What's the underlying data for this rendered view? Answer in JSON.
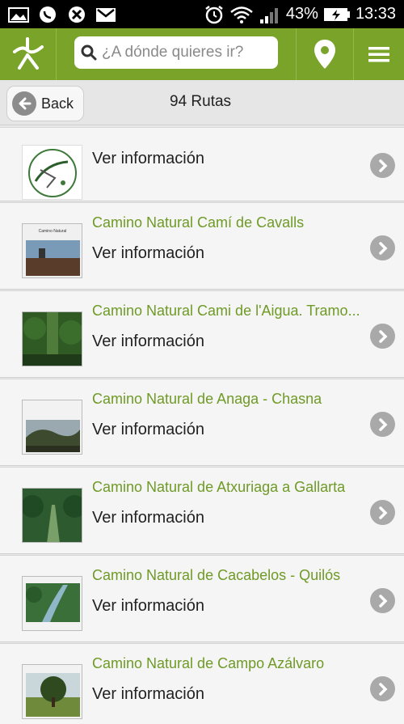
{
  "status_bar": {
    "battery": "43%",
    "time": "13:33"
  },
  "appbar": {
    "search_placeholder": "¿A dónde quieres ir?",
    "accent_color": "#7aa32a"
  },
  "subbar": {
    "back_label": "Back",
    "count_title": "94 Rutas"
  },
  "routes": [
    {
      "name": "",
      "info": "Ver información",
      "thumb": "logo"
    },
    {
      "name": "Camino Natural Camí de Cavalls",
      "info": "Ver información",
      "thumb": "coast"
    },
    {
      "name": "Camino Natural Cami de l'Aigua. Tramo...",
      "info": "Ver información",
      "thumb": "forest"
    },
    {
      "name": "Camino Natural de Anaga - Chasna",
      "info": "Ver información",
      "thumb": "mountain"
    },
    {
      "name": "Camino Natural de Atxuriaga a Gallarta",
      "info": "Ver información",
      "thumb": "path"
    },
    {
      "name": "Camino Natural de Cacabelos - Quilós",
      "info": "Ver información",
      "thumb": "river"
    },
    {
      "name": "Camino Natural de Campo Azálvaro",
      "info": "Ver información",
      "thumb": "tree"
    }
  ]
}
